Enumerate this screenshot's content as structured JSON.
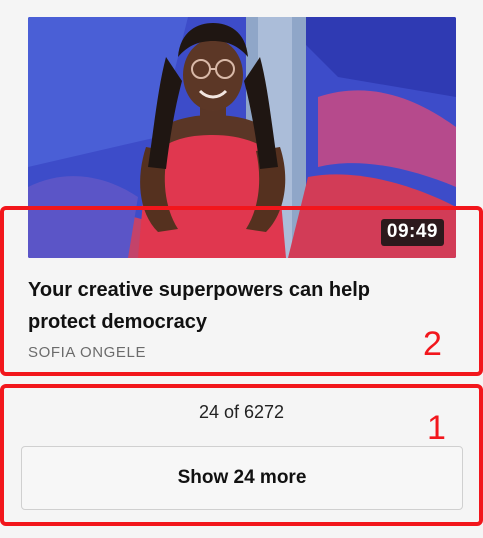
{
  "video": {
    "duration": "09:49",
    "title": "Your creative superpowers can help protect democracy",
    "speaker": "SOFIA ONGELE",
    "thumbnail_icon": "speaker-photo"
  },
  "pagination": {
    "count_text": "24 of 6272",
    "show_more_label": "Show 24 more"
  },
  "annotations": [
    {
      "label": "2",
      "color": "#f2161c"
    },
    {
      "label": "1",
      "color": "#f2161c"
    }
  ]
}
